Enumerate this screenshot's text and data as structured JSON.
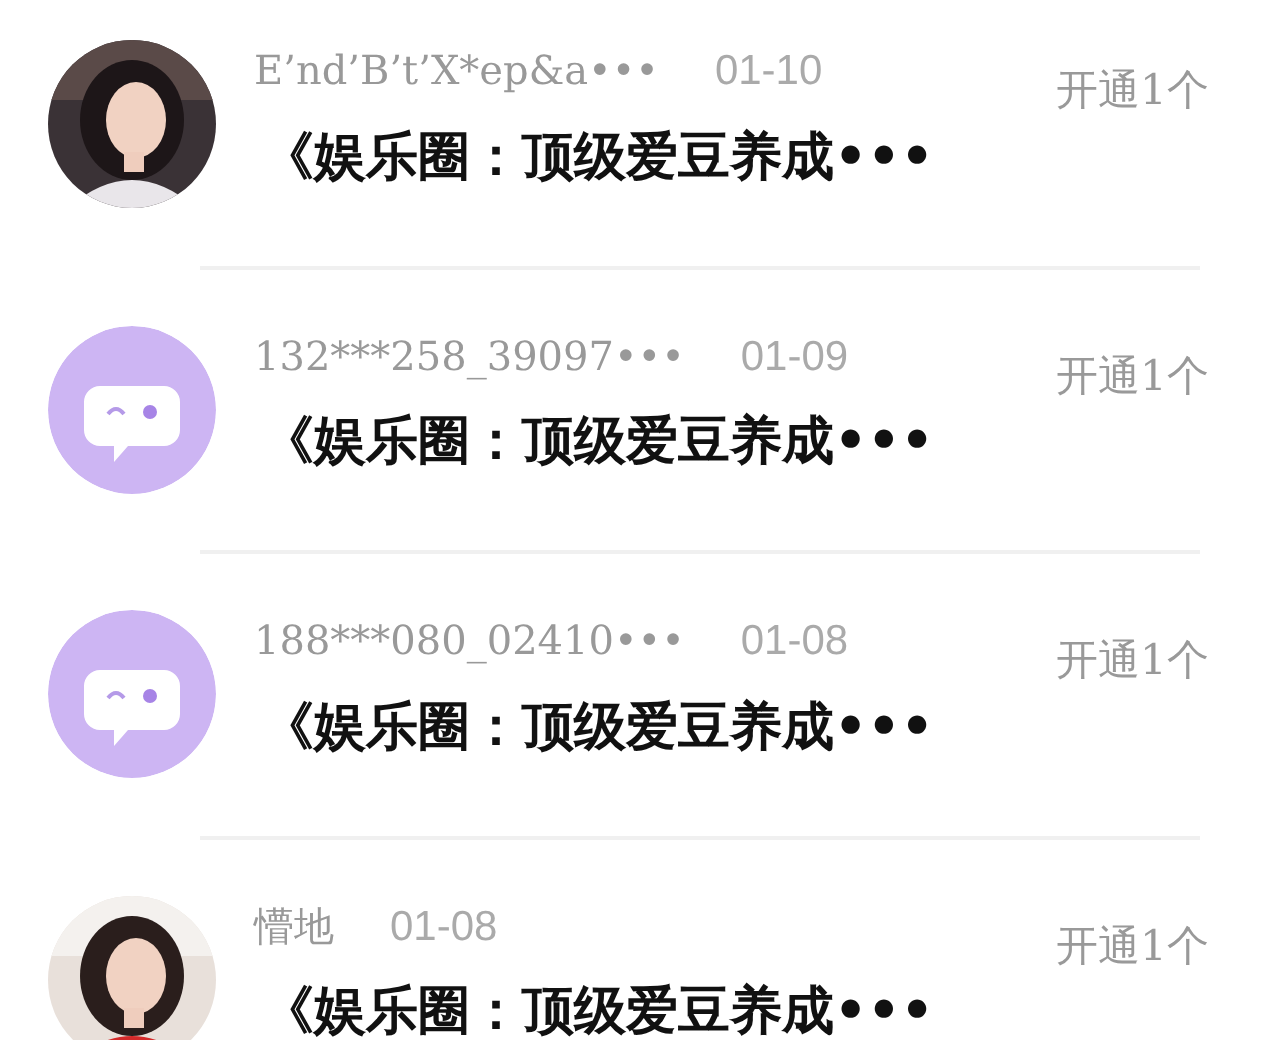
{
  "messages": [
    {
      "name": "E’nd’B’t’X*ep&a•••",
      "date": "01-10",
      "preview": "《娱乐圈：顶级爱豆养成•••",
      "action": "开通1个"
    },
    {
      "avatar": {
        "kind": "default"
      },
      "name": "132***258_39097•••",
      "date": "01-09",
      "preview": "《娱乐圈：顶级爱豆养成•••",
      "action": "开通1个"
    },
    {
      "avatar": {
        "kind": "default"
      },
      "name": "188***080_02410•••",
      "date": "01-08",
      "preview": "《娱乐圈：顶级爱豆养成•••",
      "action": "开通1个"
    },
    {
      "name": "懵地",
      "date": "01-08",
      "preview": "《娱乐圈：顶级爱豆养成•••",
      "action": "开通1个"
    }
  ]
}
